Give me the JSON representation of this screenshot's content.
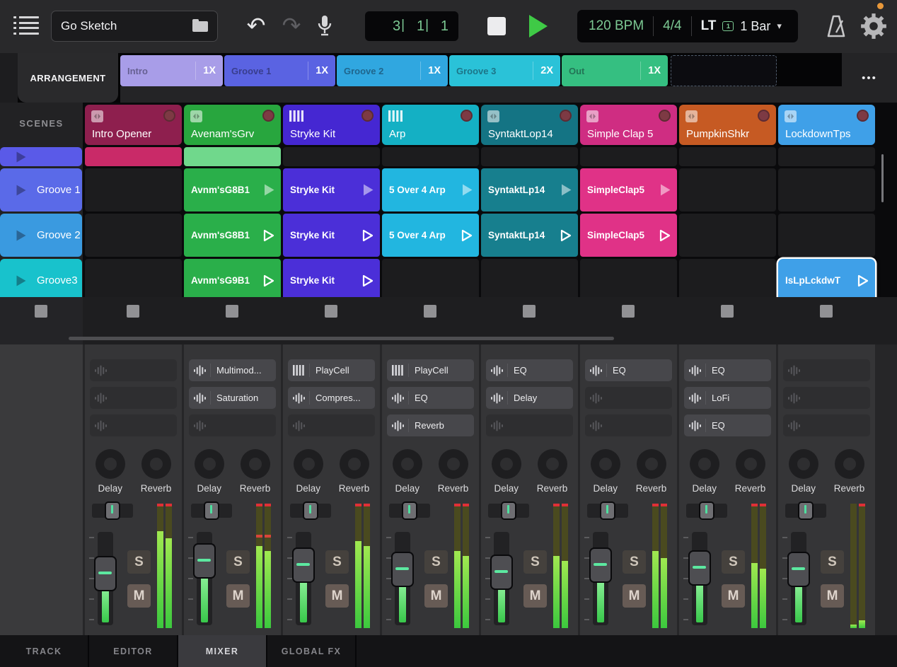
{
  "topbar": {
    "project_name": "Go Sketch",
    "position": {
      "bar": "3",
      "beat": "1",
      "sub": "1",
      "separator": "|"
    },
    "tempo": "120 BPM",
    "time_signature": "4/4",
    "loop_label": "LT",
    "loop_box": "1",
    "quantize": "1 Bar",
    "icons": {
      "undo": "↶",
      "redo": "↷",
      "caret": "▾"
    }
  },
  "arrangement": {
    "label": "ARRANGEMENT",
    "more_label": "•••",
    "sections": [
      {
        "name": "Intro",
        "repeat": "1X",
        "color": "#a89de8"
      },
      {
        "name": "Groove 1",
        "repeat": "1X",
        "color": "#5a63e2"
      },
      {
        "name": "Groove 2",
        "repeat": "1X",
        "color": "#30a7e0"
      },
      {
        "name": "Groove 3",
        "repeat": "2X",
        "color": "#2ac2d8"
      },
      {
        "name": "Out",
        "repeat": "1X",
        "color": "#35bf81"
      }
    ]
  },
  "scenes": {
    "label": "SCENES",
    "rows": [
      {
        "name": "",
        "color": "#5a5ae8"
      },
      {
        "name": "Groove 1",
        "color": "#5a6ae8"
      },
      {
        "name": "Groove 2",
        "color": "#3a9ae0"
      },
      {
        "name": "Groove3",
        "color": "#18c2cc"
      }
    ]
  },
  "tracks": [
    {
      "name": "Intro Opener",
      "color": "#8e1f4e",
      "icon": "pads"
    },
    {
      "name": "Avenam'sGrv",
      "color": "#28a63e",
      "icon": "pads"
    },
    {
      "name": "Stryke Kit",
      "color": "#4527d2",
      "icon": "keys"
    },
    {
      "name": "Arp",
      "color": "#14b0c4",
      "icon": "keys"
    },
    {
      "name": "SyntaktLop14",
      "color": "#147484",
      "icon": "pads"
    },
    {
      "name": "Simple Clap 5",
      "color": "#cf2d82",
      "icon": "pads"
    },
    {
      "name": "PumpkinShkr",
      "color": "#c65a23",
      "icon": "pads"
    },
    {
      "name": "LockdownTps",
      "color": "#3fa0e8",
      "icon": "pads"
    }
  ],
  "grid": {
    "rows": [
      {
        "cells": [
          {
            "name": "",
            "color": "#c92a68"
          },
          {
            "name": "",
            "color": "#70d88c"
          },
          null,
          null,
          null,
          null,
          null,
          null
        ]
      },
      {
        "cells": [
          null,
          {
            "name": "Avnm'sG8B1",
            "color": "#2aaf4a",
            "tri": "filled"
          },
          {
            "name": "Stryke Kit",
            "color": "#4b2fd8",
            "tri": "filled"
          },
          {
            "name": "5 Over 4 Arp",
            "color": "#22b6e0",
            "tri": "filled"
          },
          {
            "name": "SyntaktLp14",
            "color": "#177f8e",
            "tri": "filled"
          },
          {
            "name": "SimpleClap5",
            "color": "#e03287",
            "tri": "filled"
          },
          null,
          null
        ]
      },
      {
        "cells": [
          null,
          {
            "name": "Avnm'sG8B1",
            "color": "#2aaf4a",
            "tri": "outline"
          },
          {
            "name": "Stryke Kit",
            "color": "#4b2fd8",
            "tri": "outline"
          },
          {
            "name": "5 Over 4 Arp",
            "color": "#22b6e0",
            "tri": "outline"
          },
          {
            "name": "SyntaktLp14",
            "color": "#177f8e",
            "tri": "outline"
          },
          {
            "name": "SimpleClap5",
            "color": "#e03287",
            "tri": "outline"
          },
          null,
          null
        ]
      },
      {
        "cells": [
          null,
          {
            "name": "Avnm'sG9B1",
            "color": "#2aaf4a",
            "tri": "outline"
          },
          {
            "name": "Stryke Kit",
            "color": "#4b2fd8",
            "tri": "outline"
          },
          null,
          null,
          null,
          null,
          {
            "name": "IsLpLckdwT",
            "color": "#3fa0e8",
            "tri": "outline",
            "selected": true
          }
        ]
      }
    ]
  },
  "mixer": {
    "send_labels": [
      "Delay",
      "Reverb"
    ],
    "solo_label": "S",
    "mute_label": "M",
    "channels": [
      {
        "slots": [
          null,
          null,
          null
        ],
        "fader": 34,
        "meterL": 78,
        "meterR": 72,
        "clipL": true,
        "clipR": true
      },
      {
        "slots": [
          {
            "label": "Multimod...",
            "icon": "wave"
          },
          {
            "label": "Saturation",
            "icon": "wave"
          },
          null
        ],
        "fader": 16,
        "meterL": 66,
        "meterR": 62,
        "clipL": true,
        "clipR": true,
        "band": 25
      },
      {
        "slots": [
          {
            "label": "PlayCell",
            "icon": "keys"
          },
          {
            "label": "Compres...",
            "icon": "wave"
          },
          null
        ],
        "fader": 22,
        "meterL": 70,
        "meterR": 66,
        "clipL": true,
        "clipR": true
      },
      {
        "slots": [
          {
            "label": "PlayCell",
            "icon": "keys"
          },
          {
            "label": "EQ",
            "icon": "wave"
          },
          {
            "label": "Reverb",
            "icon": "wave"
          }
        ],
        "fader": 28,
        "meterL": 62,
        "meterR": 58,
        "clipL": true,
        "clipR": true
      },
      {
        "slots": [
          {
            "label": "EQ",
            "icon": "wave"
          },
          {
            "label": "Delay",
            "icon": "wave"
          },
          null
        ],
        "fader": 32,
        "meterL": 58,
        "meterR": 54,
        "clipL": true,
        "clipR": true
      },
      {
        "slots": [
          {
            "label": "EQ",
            "icon": "wave"
          },
          null,
          null
        ],
        "fader": 22,
        "meterL": 62,
        "meterR": 56,
        "clipL": true,
        "clipR": true
      },
      {
        "slots": [
          {
            "label": "EQ",
            "icon": "wave"
          },
          {
            "label": "LoFi",
            "icon": "wave"
          },
          {
            "label": "EQ",
            "icon": "wave"
          }
        ],
        "fader": 26,
        "meterL": 52,
        "meterR": 48,
        "clipL": true,
        "clipR": true
      },
      {
        "slots": [
          null,
          null,
          null
        ],
        "fader": 28,
        "meterL": 3,
        "meterR": 6,
        "clipL": false,
        "clipR": true
      }
    ]
  },
  "bottom_tabs": [
    {
      "label": "TRACK",
      "active": false
    },
    {
      "label": "EDITOR",
      "active": false
    },
    {
      "label": "MIXER",
      "active": true
    },
    {
      "label": "GLOBAL FX",
      "active": false
    }
  ]
}
